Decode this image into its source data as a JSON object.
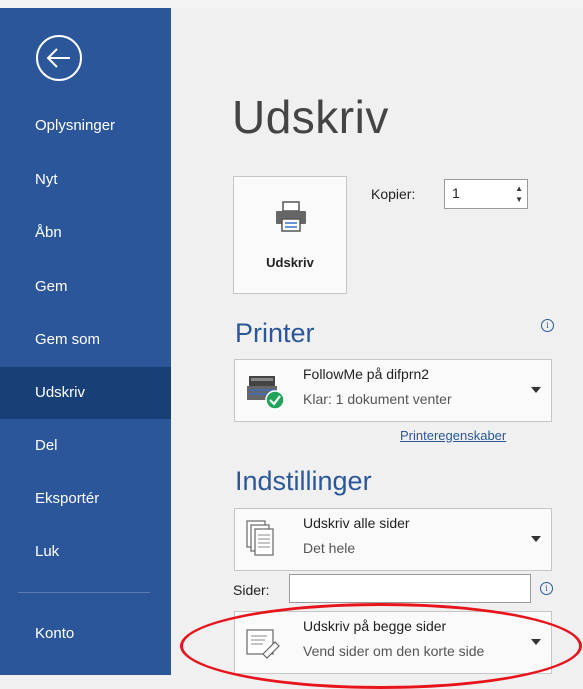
{
  "nav": {
    "back_icon": "back-arrow-circle-icon",
    "items": [
      {
        "label": "Oplysninger"
      },
      {
        "label": "Nyt"
      },
      {
        "label": "Åbn"
      },
      {
        "label": "Gem"
      },
      {
        "label": "Gem som"
      },
      {
        "label": "Udskriv",
        "active": true
      },
      {
        "label": "Del"
      },
      {
        "label": "Eksportér"
      },
      {
        "label": "Luk"
      },
      {
        "label": "Konto"
      }
    ]
  },
  "page": {
    "title": "Udskriv",
    "print_button_label": "Udskriv",
    "print_icon": "printer-icon",
    "copies_label": "Kopier:",
    "copies_value": "1"
  },
  "printer": {
    "heading": "Printer",
    "name": "FollowMe på difprn2",
    "status": "Klar: 1 dokument venter",
    "properties_link": "Printeregenskaber",
    "icon": "printer-ready-icon"
  },
  "settings": {
    "heading": "Indstillinger",
    "pages_option_title": "Udskriv alle sider",
    "pages_option_subtitle": "Det hele",
    "pages_label": "Sider:",
    "pages_value": "",
    "duplex_option_title": "Udskriv på begge sider",
    "duplex_option_subtitle": "Vend sider om den korte side"
  },
  "colors": {
    "sidebar": "#2b579a",
    "sidebar_active": "#193f77",
    "accent": "#2b579a",
    "annotation": "#e8141c"
  }
}
